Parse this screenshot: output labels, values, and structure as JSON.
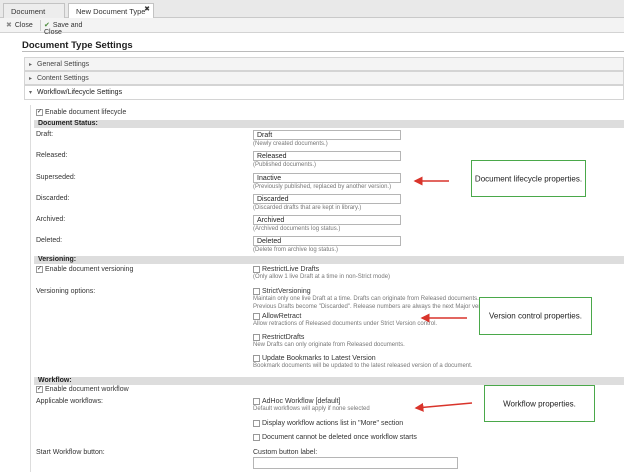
{
  "tabs": [
    {
      "label": "Document Types"
    },
    {
      "label": "New Document Type"
    }
  ],
  "toolbar": {
    "close": "Close",
    "save_close": "Save and Close"
  },
  "page_title": "Document Type Settings",
  "sections": {
    "general": "General Settings",
    "content": "Content Settings",
    "workflow": "Workflow/Lifecycle Settings"
  },
  "lifecycle": {
    "enable_label": "Enable document lifecycle",
    "status_header": "Document Status:",
    "rows": [
      {
        "label": "Draft:",
        "value": "Draft",
        "hint": "(Newly created documents.)"
      },
      {
        "label": "Released:",
        "value": "Released",
        "hint": "(Published documents.)"
      },
      {
        "label": "Superseded:",
        "value": "Inactive",
        "hint": "(Previously published, replaced by another version.)"
      },
      {
        "label": "Discarded:",
        "value": "Discarded",
        "hint": "(Discarded drafts that are kept in library.)"
      },
      {
        "label": "Archived:",
        "value": "Archived",
        "hint": "(Archived documents log status.)"
      },
      {
        "label": "Deleted:",
        "value": "Deleted",
        "hint": "(Delete from archive log status.)"
      }
    ]
  },
  "versioning": {
    "header": "Versioning:",
    "enable_label": "Enable document versioning",
    "restrict_live": "RestrictLive Drafts",
    "restrict_live_hint": "(Only allow 1 live Draft at a time in non-Strict mode)",
    "options_label": "Versioning options:",
    "strict": "StrictVersioning",
    "strict_hint1": "Maintain only one live Draft at a time. Drafts can originate from Released documents.",
    "strict_hint2": "Previous Drafts become \"Discarded\". Release numbers are always the next Major version.",
    "allow_retract": "AllowRetract",
    "allow_retract_hint": "Allow retractions of Released documents under Strict Version control.",
    "restrict_drafts": "RestrictDrafts",
    "restrict_drafts_hint": "New Drafts can only originate from Released documents.",
    "update_bookmarks": "Update Bookmarks to Latest Version",
    "update_bookmarks_hint": "Bookmark documents will be updated to the latest released version of a document."
  },
  "workflow": {
    "header": "Workflow:",
    "enable_label": "Enable document workflow",
    "applicable_label": "Applicable workflows:",
    "adhoc": "AdHoc Workflow [default]",
    "adhoc_hint": "Default workflows will apply if none selected",
    "display_more": "Display workflow actions list in \"More\" section",
    "cannot_delete": "Document cannot be deleted once workflow starts",
    "start_button_label": "Start Workflow button:",
    "custom_button_label": "Custom button label:"
  },
  "callouts": {
    "lifecycle": "Document lifecycle properties.",
    "version": "Version control properties.",
    "workflow": "Workflow properties."
  },
  "colors": {
    "callout_border": "#4aa84a",
    "arrow": "#d9342b"
  }
}
